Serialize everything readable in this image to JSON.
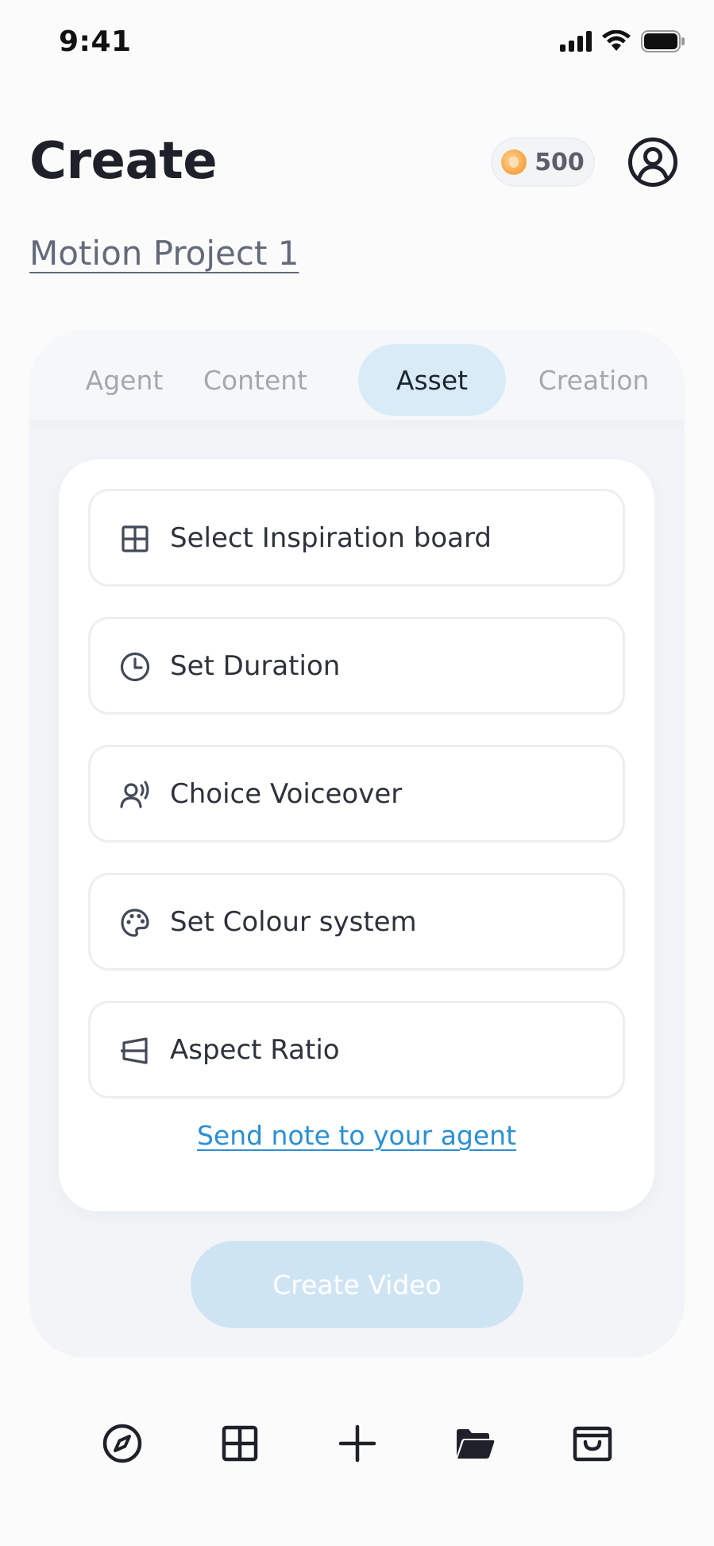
{
  "status_bar": {
    "time": "9:41"
  },
  "header": {
    "title": "Create",
    "credits": "500"
  },
  "project": {
    "name": "Motion Project 1"
  },
  "tabs": [
    {
      "label": "Agent",
      "active": false
    },
    {
      "label": "Content",
      "active": false
    },
    {
      "label": "Asset",
      "active": true
    },
    {
      "label": "Creation",
      "active": false
    }
  ],
  "options": [
    {
      "label": "Select Inspiration board",
      "icon": "grid-icon"
    },
    {
      "label": "Set Duration",
      "icon": "clock-icon"
    },
    {
      "label": "Choice Voiceover",
      "icon": "voice-icon"
    },
    {
      "label": "Set Colour system",
      "icon": "palette-icon"
    },
    {
      "label": "Aspect Ratio",
      "icon": "aspect-ratio-icon"
    }
  ],
  "note_link": "Send note to your agent",
  "create_button": "Create Video",
  "bottom_nav": [
    "compass-icon",
    "grid-icon",
    "plus-icon",
    "folder-icon",
    "inbox-icon"
  ],
  "colors": {
    "accent": "#2b8fd1",
    "active_tab": "#d8ebf7",
    "button_disabled": "#cfe4f3"
  }
}
